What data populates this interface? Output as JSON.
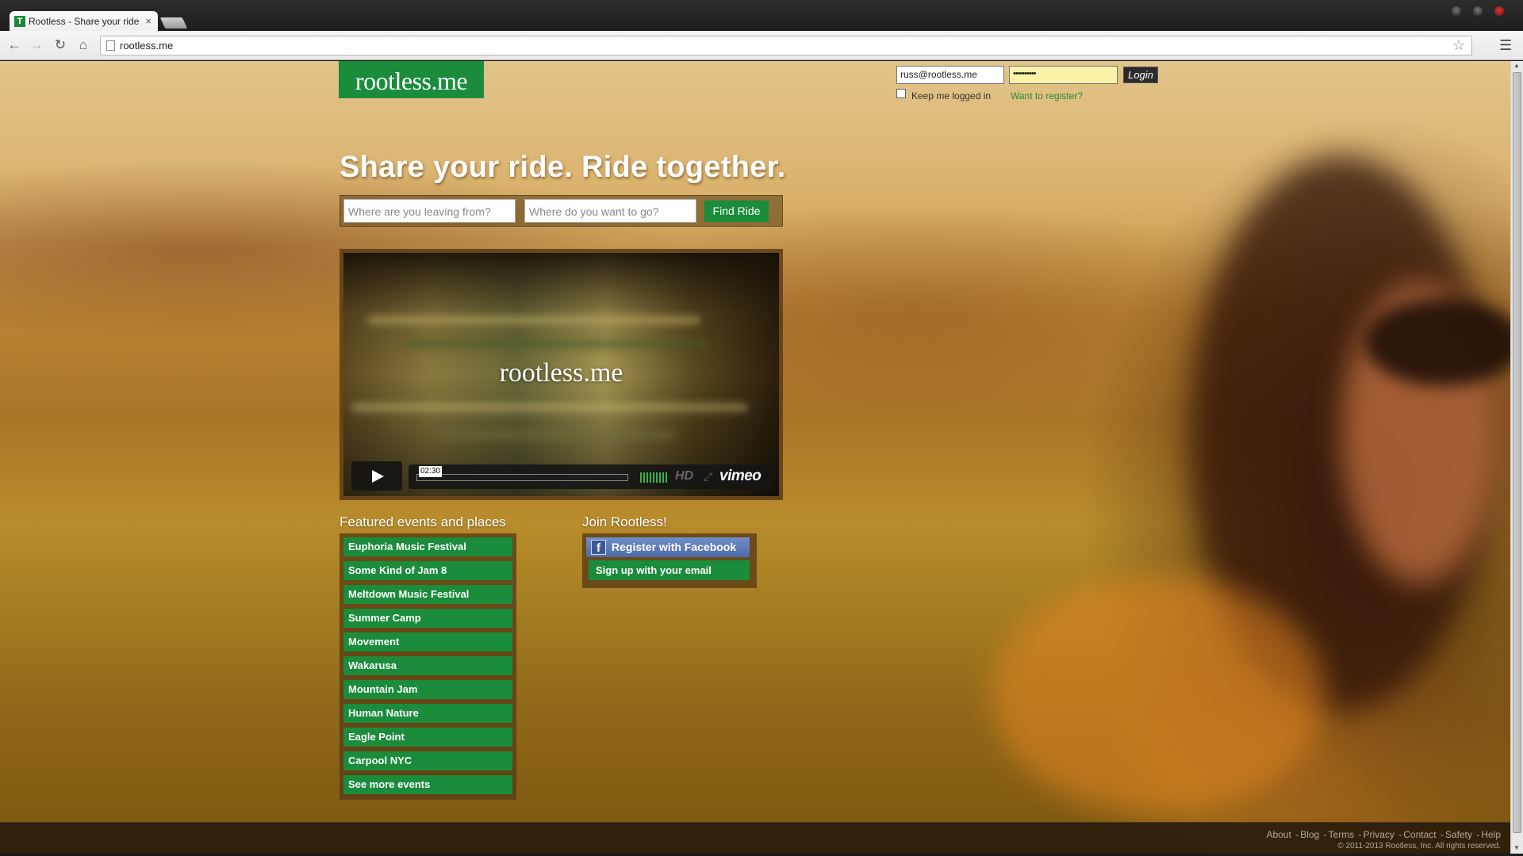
{
  "browser": {
    "tab_title": "Rootless - Share your ride",
    "tab_favicon": "T",
    "tab_close": "×",
    "url": "rootless.me"
  },
  "page": {
    "logo": "rootless.me",
    "login": {
      "email_value": "russ@rootless.me",
      "password_value": "••••••••••",
      "button_label": "Login",
      "keep_logged_in_label": "Keep me logged in",
      "register_link": "Want to register?"
    },
    "headline": "Share your ride. Ride together.",
    "search": {
      "from_placeholder": "Where are you leaving from?",
      "to_placeholder": "Where do you want to go?",
      "button_label": "Find Ride"
    },
    "video": {
      "title": "rootless.me",
      "duration": "02:30",
      "hd_label": "HD",
      "provider": "vimeo"
    },
    "featured": {
      "heading": "Featured events and places",
      "items": [
        "Euphoria Music Festival",
        "Some Kind of Jam 8",
        "Meltdown Music Festival",
        "Summer Camp",
        "Movement",
        "Wakarusa",
        "Mountain Jam",
        "Human Nature",
        "Eagle Point",
        "Carpool NYC",
        "See more events"
      ]
    },
    "join": {
      "heading": "Join Rootless!",
      "facebook_label": "Register with Facebook",
      "facebook_icon_letter": "f",
      "email_label": "Sign up with your email"
    },
    "footer": {
      "links": [
        "About",
        "Blog",
        "Terms",
        "Privacy",
        "Contact",
        "Safety",
        "Help"
      ],
      "copyright": "© 2011-2013 Rootless, Inc. All rights reserved."
    }
  },
  "colors": {
    "brand_green": "#1a8c3c",
    "password_bg": "#fbf4a8",
    "facebook_blue": "#4e6aa8"
  },
  "icons": [
    "back-arrow-icon",
    "forward-arrow-icon",
    "reload-icon",
    "home-icon",
    "page-icon",
    "star-icon",
    "menu-icon",
    "play-icon",
    "fullscreen-icon",
    "facebook-icon"
  ]
}
